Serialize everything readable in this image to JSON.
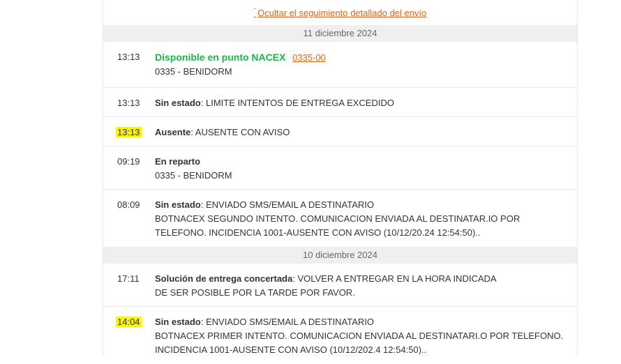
{
  "toggle": {
    "caret": "ˆ",
    "label": "Ocultar el seguimiento detallado del envío"
  },
  "days": [
    {
      "date": "11 diciembre 2024",
      "events": [
        {
          "time": "13:13",
          "status": "Disponible en punto NACEX",
          "code": "0335-00",
          "detail": "0335 - BENIDORM"
        },
        {
          "time": "13:13",
          "status": "Sin estado",
          "text": ": LIMITE INTENTOS DE ENTREGA EXCEDIDO"
        },
        {
          "time": "13:13",
          "status": "Ausente",
          "text": ": AUSENTE CON AVISO",
          "highlight": true
        },
        {
          "time": "09:19",
          "status": "En reparto",
          "detail": "0335 - BENIDORM"
        },
        {
          "time": "08:09",
          "status": "Sin estado",
          "text": ": ENVIADO SMS/EMAIL A DESTINATARIO",
          "detail1": "BOTNACEX SEGUNDO INTENTO. COMUNICACION ENVIADA AL DESTINATAR.IO POR",
          "detail2": "TELEFONO. INCIDENCIA 1001-AUSENTE CON AVISO (10/12/20.24 12:54:50).."
        }
      ]
    },
    {
      "date": "10 diciembre 2024",
      "events": [
        {
          "time": "17:11",
          "status": "Solución de entrega concertada",
          "text": ": VOLVER A ENTREGAR EN LA HORA INDICADA",
          "detail": "DE SER POSIBLE POR LA TARDE POR FAVOR."
        },
        {
          "time": "14:04",
          "status": "Sin estado",
          "text": ": ENVIADO SMS/EMAIL A DESTINATARIO",
          "highlight": true,
          "detail1": "BOTNACEX PRIMER INTENTO. COMUNICACION ENVIADA AL DESTINATARI.O POR TELEFONO.",
          "detail2": "INCIDENCIA 1001-AUSENTE CON AVISO (10/12/202.4 12:54:50).."
        }
      ]
    }
  ],
  "colors": {
    "accent": "#e8611a",
    "available": "#1db34a",
    "highlight": "#f6f21a"
  }
}
